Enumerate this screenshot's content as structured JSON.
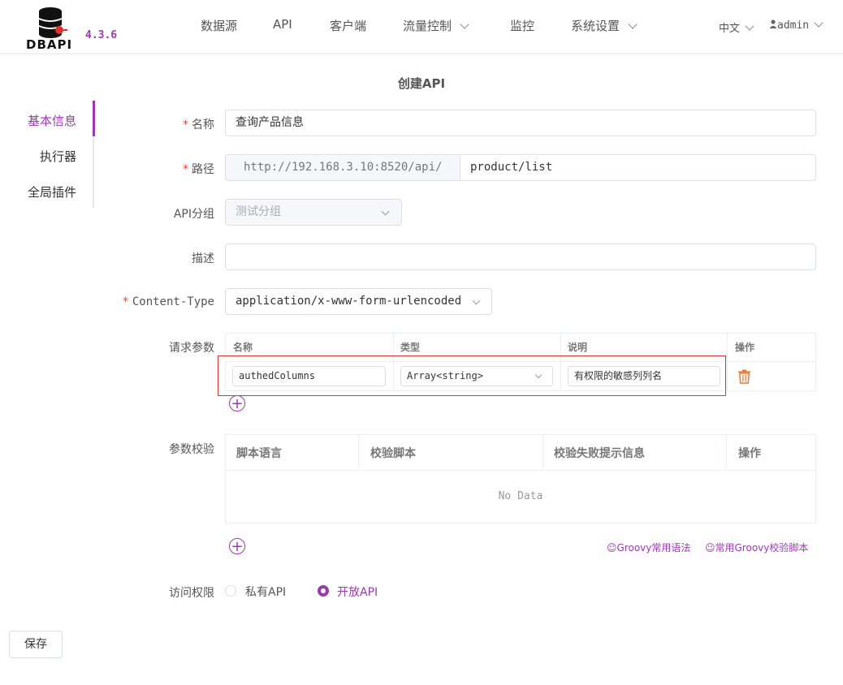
{
  "header": {
    "logo_text": "DBAPI",
    "version": "4.3.6",
    "nav": [
      {
        "label": "数据源",
        "dropdown": false
      },
      {
        "label": "API",
        "dropdown": false
      },
      {
        "label": "客户端",
        "dropdown": false
      },
      {
        "label": "流量控制",
        "dropdown": true
      },
      {
        "label": "监控",
        "dropdown": false
      },
      {
        "label": "系统设置",
        "dropdown": true
      }
    ],
    "language": "中文",
    "user": "admin"
  },
  "page_title": "创建API",
  "sidebar": {
    "items": [
      {
        "label": "基本信息",
        "active": true
      },
      {
        "label": "执行器",
        "active": false
      },
      {
        "label": "全局插件",
        "active": false
      }
    ]
  },
  "form": {
    "name_label": "名称",
    "name_value": "查询产品信息",
    "path_label": "路径",
    "path_prefix": "http://192.168.3.10:8520/api/",
    "path_value": "product/list",
    "group_label": "API分组",
    "group_value": "测试分组",
    "desc_label": "描述",
    "desc_value": "",
    "content_type_label": "Content-Type",
    "content_type_value": "application/x-www-form-urlencoded",
    "params_label": "请求参数",
    "params_headers": [
      "名称",
      "类型",
      "说明",
      "操作"
    ],
    "params_rows": [
      {
        "name": "authedColumns",
        "type": "Array<string>",
        "desc": "有权限的敏感列列名"
      }
    ],
    "validation_label": "参数校验",
    "validation_headers": [
      "脚本语言",
      "校验脚本",
      "校验失败提示信息",
      "操作"
    ],
    "validation_empty": "No Data",
    "groovy_link1": "☺Groovy常用语法",
    "groovy_link2": "☺常用Groovy校验脚本",
    "access_label": "访问权限",
    "access_options": [
      {
        "label": "私有API",
        "selected": false
      },
      {
        "label": "开放API",
        "selected": true
      }
    ],
    "save_label": "保存"
  },
  "colors": {
    "accent": "#9b3ab0",
    "required": "#e5483f",
    "highlight_box": "#e03030",
    "delete_icon": "#e07a3a"
  }
}
